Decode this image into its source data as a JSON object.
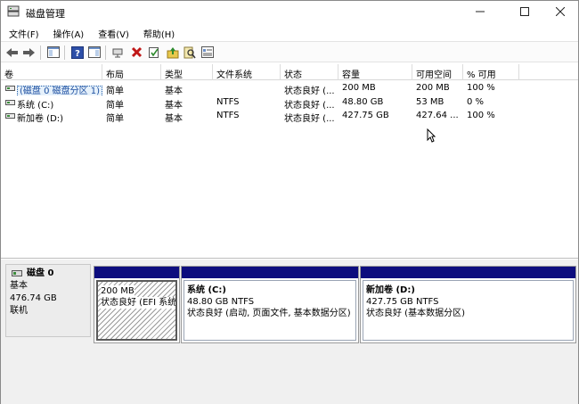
{
  "window": {
    "title": "磁盘管理"
  },
  "menu": [
    "文件(F)",
    "操作(A)",
    "查看(V)",
    "帮助(H)"
  ],
  "toolbar_icons": [
    "back-icon",
    "forward-icon",
    "console-tree-icon",
    "help-icon",
    "details-pane-icon",
    "connect-icon",
    "delete-icon",
    "check-icon",
    "up-folder-icon",
    "search-icon",
    "properties-icon"
  ],
  "volume_list": {
    "columns": [
      "卷",
      "布局",
      "类型",
      "文件系统",
      "状态",
      "容量",
      "可用空间",
      "% 可用"
    ],
    "rows": [
      [
        "(磁盘 0 磁盘分区 1)",
        "简单",
        "基本",
        "",
        "状态良好 (...",
        "200 MB",
        "200 MB",
        "100 %"
      ],
      [
        "系统 (C:)",
        "简单",
        "基本",
        "NTFS",
        "状态良好 (...",
        "48.80 GB",
        "53 MB",
        "0 %"
      ],
      [
        "新加卷 (D:)",
        "简单",
        "基本",
        "NTFS",
        "状态良好 (...",
        "427.75 GB",
        "427.64 ...",
        "100 %"
      ]
    ]
  },
  "disk": {
    "name": "磁盘 0",
    "type": "基本",
    "size": "476.74 GB",
    "status": "联机"
  },
  "partitions": [
    {
      "name": "",
      "size": "200 MB",
      "status": "状态良好 (EFI 系统"
    },
    {
      "name": "系统  (C:)",
      "size": "48.80 GB NTFS",
      "status": "状态良好 (启动, 页面文件, 基本数据分区)"
    },
    {
      "name": "新加卷  (D:)",
      "size": "427.75 GB NTFS",
      "status": "状态良好 (基本数据分区)"
    }
  ],
  "colors": {
    "partition_bar": "#0d0d7e",
    "selection": "#1e5ba8"
  }
}
